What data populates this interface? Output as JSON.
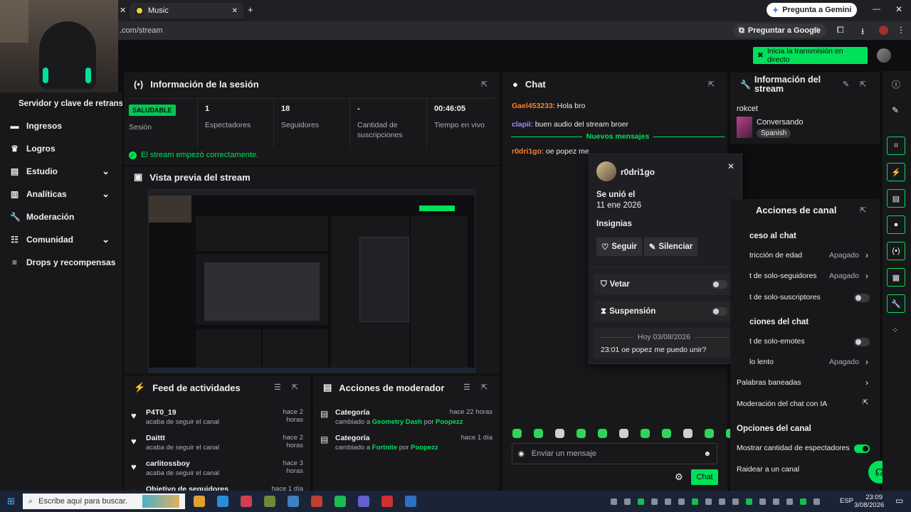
{
  "browser": {
    "tab_title": "Music",
    "url": ".com/stream",
    "gemini_button": "Pregunta a Gemini",
    "google_button": "Preguntar a Google"
  },
  "header": {
    "start_stream": "Inicia la transmisión en directo"
  },
  "sidebar": {
    "title": "Servidor y clave de retransm",
    "items": [
      {
        "label": "Ingresos",
        "icon": "money-icon",
        "expand": false
      },
      {
        "label": "Logros",
        "icon": "trophy-icon",
        "expand": false
      },
      {
        "label": "Estudio",
        "icon": "studio-icon",
        "expand": true
      },
      {
        "label": "Analíticas",
        "icon": "chart-icon",
        "expand": true
      },
      {
        "label": "Moderación",
        "icon": "wrench-icon",
        "expand": false
      },
      {
        "label": "Comunidad",
        "icon": "sliders-icon",
        "expand": true
      },
      {
        "label": "Drops y recompensas",
        "icon": "list-icon",
        "expand": false
      }
    ]
  },
  "session": {
    "title": "Información de la sesión",
    "status_badge": "SALUDABLE",
    "status_label": "Sesión",
    "stats": [
      {
        "value": "1",
        "label": "Espectadores"
      },
      {
        "value": "18",
        "label": "Seguidores"
      },
      {
        "value": "-",
        "label": "Cantidad de suscripciones"
      },
      {
        "value": "00:46:05",
        "label": "Tiempo en vivo"
      }
    ],
    "message": "El stream empezó correctamente."
  },
  "preview": {
    "title": "Vista previa del stream"
  },
  "activity": {
    "title": "Feed de actividades",
    "items": [
      {
        "user": "P4T0_19",
        "action": "acaba de seguir el canal",
        "time": "hace 2 horas"
      },
      {
        "user": "Daittt",
        "action": "acaba de seguir el canal",
        "time": "hace 2 horas"
      },
      {
        "user": "carlitossboy",
        "action": "acaba de seguir el canal",
        "time": "hace 3 horas"
      },
      {
        "user": "Objetivo de seguidores",
        "action": "",
        "time": "hace 1 día"
      }
    ]
  },
  "mod_actions": {
    "title": "Acciones de moderador",
    "items": [
      {
        "type": "Categoría",
        "prefix": "cambiado a",
        "target": "Geometry Dash",
        "by": "por",
        "user": "Poopezz",
        "time": "hace 22 horas"
      },
      {
        "type": "Categoría",
        "prefix": "cambiado a",
        "target": "Fortnite",
        "by": "por",
        "user": "Poopezz",
        "time": "hace 1 día"
      }
    ]
  },
  "chat": {
    "title": "Chat",
    "messages": [
      {
        "user": "Gael453233",
        "text": "Hola bro",
        "color": "#ff7f27"
      },
      {
        "user": "clapii",
        "text": "buen audio del stream broer",
        "color": "#9b8cff"
      }
    ],
    "new_messages": "Nuevos mensajes",
    "after_messages": [
      {
        "user": "r0dri1go",
        "text": "oe popez me",
        "color": "#ff7f27"
      }
    ],
    "input_placeholder": "Enviar un mensaje",
    "send_button": "Chat"
  },
  "user_card": {
    "username": "r0dri1go",
    "joined_label": "Se unió el",
    "joined_date": "11 ene 2026",
    "badges_label": "Insignias",
    "follow_button": "Seguir",
    "mute_button": "Silenciar",
    "ban_label": "Vetar",
    "timeout_label": "Suspensión",
    "date_divider": "Hoy 03/08/2026",
    "message": "23:01 oe popez me puedo unir?"
  },
  "stream_info": {
    "title": "Información del stream",
    "title_line1": "Información del",
    "title_line2": "stream",
    "stream_title": "rokcet",
    "category": "Conversando",
    "language": "Spanish"
  },
  "channel_actions": {
    "title": "Acciones de canal",
    "section1": "ceso al chat",
    "rows1": [
      {
        "label": "tricción de edad",
        "value": "Apagado",
        "kind": "chev"
      },
      {
        "label": "t de solo-seguidores",
        "value": "Apagado",
        "kind": "chev"
      },
      {
        "label": "t de solo-suscriptores",
        "value": "",
        "kind": "toggle-off"
      }
    ],
    "section2": "ciones del chat",
    "rows2": [
      {
        "label": "t de solo-emotes",
        "value": "",
        "kind": "toggle-off"
      },
      {
        "label": "lo lento",
        "value": "Apagado",
        "kind": "chev"
      },
      {
        "label": "Palabras baneadas",
        "value": "",
        "kind": "chev"
      },
      {
        "label": "Moderación del chat con IA",
        "value": "",
        "kind": "ext"
      }
    ],
    "section3": "Opciones del canal",
    "rows3": [
      {
        "label": "Mostrar cantidad de espectadores",
        "value": "",
        "kind": "toggle-on"
      },
      {
        "label": "Raidear a un canal",
        "value": "",
        "kind": "none"
      }
    ]
  },
  "taskbar": {
    "search_placeholder": "Escribe aquí para buscar.",
    "language": "ESP",
    "time": "23:09",
    "date": "3/08/2026"
  },
  "colors": {
    "accent": "#00e05a",
    "panel": "#18181b",
    "bg": "#0e0e10"
  }
}
